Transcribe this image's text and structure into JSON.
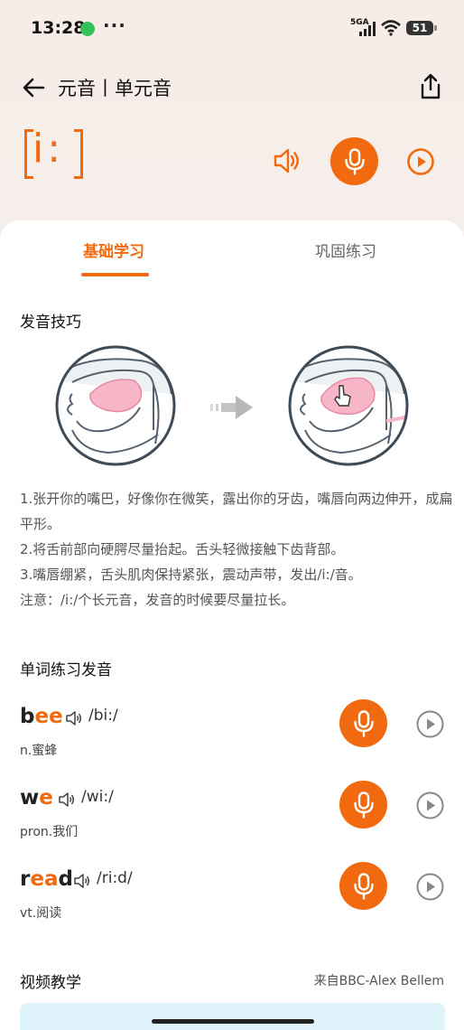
{
  "status_bar": {
    "time": "13:28",
    "dots": "···",
    "network": "5GA",
    "battery": "51"
  },
  "header": {
    "title": "元音丨单元音",
    "phoneme": "i:"
  },
  "colors": {
    "accent": "#f26a0f",
    "background": "#f5ebe6"
  },
  "tabs": [
    {
      "label": "基础学习",
      "active": true
    },
    {
      "label": "巩固练习",
      "active": false
    }
  ],
  "pronunciation": {
    "title": "发音技巧",
    "tips": [
      "1.张开你的嘴巴，好像你在微笑，露出你的牙齿，嘴唇向两边伸开，成扁平形。",
      "2.将舌前部向硬腭尽量抬起。舌头轻微接触下齿背部。",
      "3.嘴唇绷紧，舌头肌肉保持紧张，震动声带，发出/i:/音。",
      "注意：/i:/个长元音，发音的时候要尽量拉长。"
    ]
  },
  "words_section": {
    "title": "单词练习发音",
    "words": [
      {
        "prefix": "b",
        "highlight": "ee",
        "suffix": "",
        "phonetic": "/bi:/",
        "definition": "n.蜜蜂"
      },
      {
        "prefix": "w",
        "highlight": "e",
        "suffix": "",
        "phonetic": "/wi:/",
        "definition": "pron.我们"
      },
      {
        "prefix": "r",
        "highlight": "ea",
        "suffix": "d",
        "phonetic": "/ri:d/",
        "definition": "vt.阅读"
      }
    ]
  },
  "video_section": {
    "title": "视频教学",
    "source": "来自BBC-Alex Bellem"
  },
  "icons": [
    "back-arrow-icon",
    "share-icon",
    "speaker-icon",
    "microphone-icon",
    "play-icon"
  ]
}
